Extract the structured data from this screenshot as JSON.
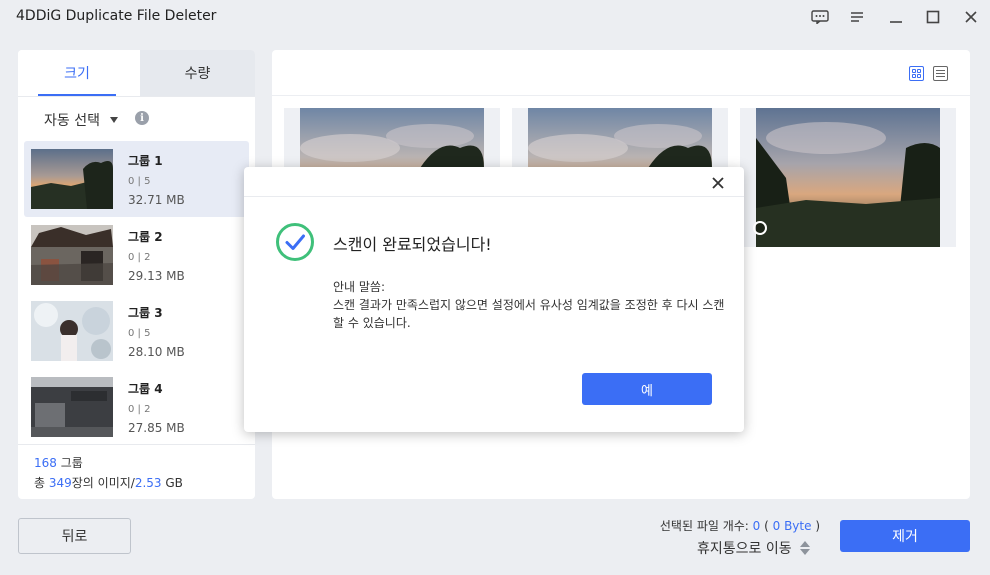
{
  "app": {
    "title": "4DDiG Duplicate File Deleter"
  },
  "window_controls": [
    {
      "name": "feedback-icon"
    },
    {
      "name": "menu-icon"
    },
    {
      "name": "minimize-icon"
    },
    {
      "name": "maximize-icon"
    },
    {
      "name": "close-icon"
    }
  ],
  "left_panel": {
    "tabs": [
      {
        "label": "크기",
        "active": true
      },
      {
        "label": "수량",
        "active": false
      }
    ],
    "auto_select_label": "자동 선택",
    "groups": [
      {
        "name": "그룹 1",
        "selection": "0 | 5",
        "size": "32.71 MB",
        "active": true
      },
      {
        "name": "그룹 2",
        "selection": "0 | 2",
        "size": "29.13 MB",
        "active": false
      },
      {
        "name": "그룹 3",
        "selection": "0 | 5",
        "size": "28.10 MB",
        "active": false
      },
      {
        "name": "그룹 4",
        "selection": "0 | 2",
        "size": "27.85 MB",
        "active": false
      }
    ],
    "footer": {
      "group_count": "168",
      "group_suffix": " 그룹",
      "total_prefix": "총 ",
      "image_count": "349",
      "image_mid": "장의 이미지/",
      "total_size": "2.53",
      "size_unit": " GB"
    }
  },
  "right_panel": {
    "view_modes": [
      "grid-view-icon",
      "list-view-icon"
    ],
    "active_view": "grid-view-icon"
  },
  "bottom_bar": {
    "back_label": "뒤로",
    "selected_prefix": "선택된 파일 개수: ",
    "selected_count": "0",
    "selected_size_open": " ( ",
    "selected_size": "0 Byte",
    "selected_size_close": " )",
    "move_option": "휴지통으로 이동",
    "remove_label": "제거"
  },
  "dialog": {
    "title": "스캔이 완료되었습니다!",
    "body_heading": "안내 말씀:",
    "body_text": "스캔 결과가 만족스럽지 않으면 설정에서 유사성 임계값을 조정한 후 다시 스캔할 수 있습니다.",
    "ok_label": "예"
  },
  "colors": {
    "accent": "#3b6ef5",
    "success": "#3fc07a",
    "background": "#eceef2"
  }
}
